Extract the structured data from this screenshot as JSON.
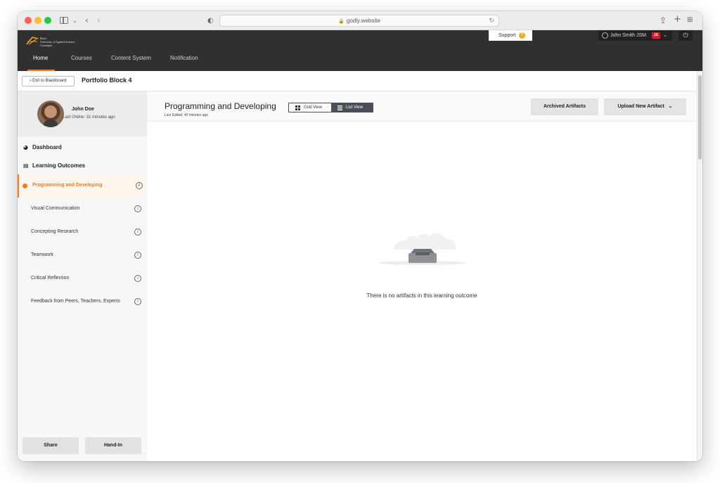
{
  "browser": {
    "url": "godly.website"
  },
  "header": {
    "logo_text_line1": "Baser",
    "logo_text_line2": "University of Applied Sciences",
    "logo_text_line3": "Groningen",
    "support_label": "Support",
    "support_icon": "?",
    "user_name": "John Smith JSM",
    "notification_count": "16",
    "nav": [
      {
        "label": "Home"
      },
      {
        "label": "Courses"
      },
      {
        "label": "Content System"
      },
      {
        "label": "Notification"
      }
    ]
  },
  "subheader": {
    "exit_label": "Exit to Blackboard",
    "title": "Portfolio Block 4"
  },
  "profile": {
    "name": "John Doe",
    "last_online": "Last Online: 31 minutes ago"
  },
  "sidebar": {
    "dashboard_label": "Dashboard",
    "outcomes_label": "Learning Outcomes",
    "outcomes": [
      {
        "label": "Programming and Developing"
      },
      {
        "label": "Visual Communication"
      },
      {
        "label": "Concepting Research"
      },
      {
        "label": "Teamwork"
      },
      {
        "label": "Critical Reflection"
      },
      {
        "label": "Feedback from Peers, Teachers, Experts"
      }
    ],
    "share_label": "Share",
    "handin_label": "Hand-In"
  },
  "main": {
    "title": "Programming and Developing",
    "last_edited": "Last Edited: 40 minutes ago",
    "grid_view_label": "Grid View",
    "list_view_label": "List View",
    "archived_label": "Archived Artifacts",
    "upload_label": "Upload New Artifact",
    "empty_message": "There is no artifacts in this learning outcome"
  },
  "colors": {
    "accent": "#f37c22",
    "appbar": "#303030",
    "badge": "#d81f26"
  }
}
